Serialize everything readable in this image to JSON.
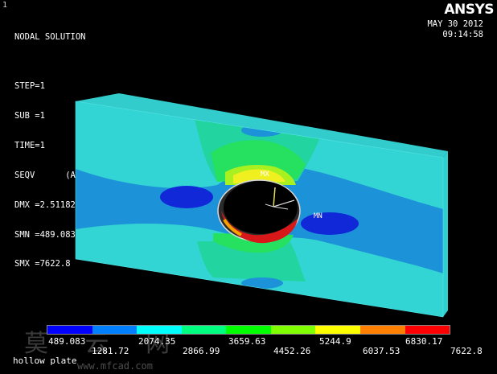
{
  "window_number": "1",
  "info_lines": [
    "NODAL SOLUTION",
    "",
    "STEP=1",
    "SUB =1",
    "TIME=1",
    "SEQV      (AVG)",
    "DMX =2.51182",
    "SMN =489.083",
    "SMX =7622.8"
  ],
  "logo": "ANSYS",
  "date": "MAY 30 2012",
  "time": "09:14:58",
  "markers": {
    "max": "MX",
    "min": "MN"
  },
  "legend": {
    "upper": [
      "489.083",
      "2074.35",
      "3659.63",
      "5244.9",
      "6830.17"
    ],
    "lower": [
      "1281.72",
      "2866.99",
      "4452.26",
      "6037.53",
      "7622.8"
    ],
    "colors": [
      "#0000ff",
      "#0080ff",
      "#00ffff",
      "#00ff80",
      "#00ff00",
      "#80ff00",
      "#ffff00",
      "#ff8000",
      "#ff0000"
    ]
  },
  "plot_title": "hollow plate",
  "watermark": "莫 云 网",
  "watermark_url": "www.mfcad.com"
}
